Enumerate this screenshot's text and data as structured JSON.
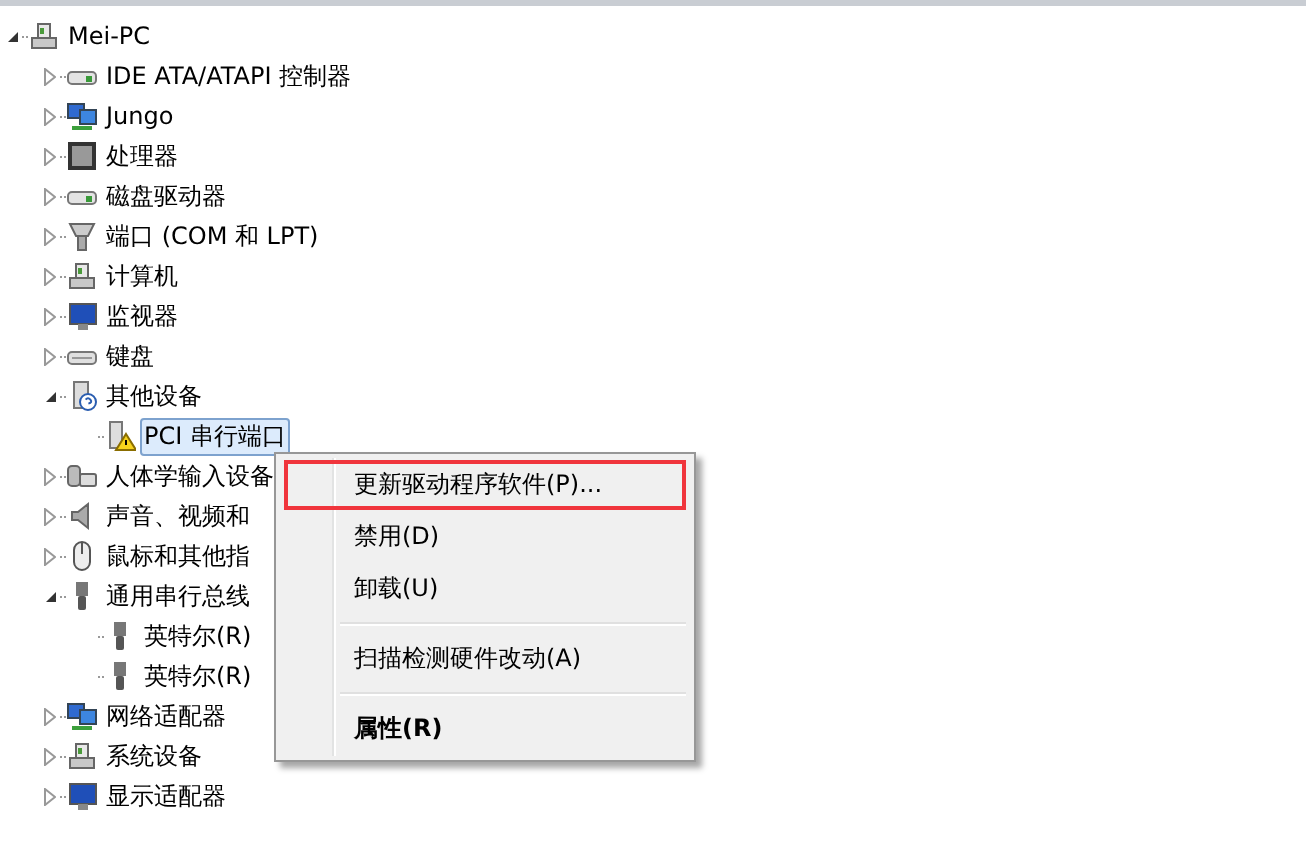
{
  "tree": [
    {
      "label": "Mei-PC",
      "expanded": true,
      "selected": false,
      "children": [
        {
          "label": "IDE ATA/ATAPI 控制器",
          "expanded": false,
          "selected": false
        },
        {
          "label": "Jungo",
          "expanded": false,
          "selected": false
        },
        {
          "label": "处理器",
          "expanded": false,
          "selected": false
        },
        {
          "label": "磁盘驱动器",
          "expanded": false,
          "selected": false
        },
        {
          "label": "端口 (COM 和 LPT)",
          "expanded": false,
          "selected": false
        },
        {
          "label": "计算机",
          "expanded": false,
          "selected": false
        },
        {
          "label": "监视器",
          "expanded": false,
          "selected": false
        },
        {
          "label": "键盘",
          "expanded": false,
          "selected": false
        },
        {
          "label": "其他设备",
          "expanded": true,
          "selected": false,
          "children": [
            {
              "label": "PCI 串行端口",
              "selected": true
            }
          ]
        },
        {
          "label": "人体学输入设备",
          "expanded": false,
          "selected": false
        },
        {
          "label": "声音、视频和",
          "expanded": false,
          "selected": false
        },
        {
          "label": "鼠标和其他指",
          "expanded": false,
          "selected": false
        },
        {
          "label": "通用串行总线",
          "expanded": true,
          "selected": false,
          "children": [
            {
              "label": "英特尔(R)",
              "selected": false
            },
            {
              "label": "英特尔(R)",
              "selected": false
            }
          ]
        },
        {
          "label": "网络适配器",
          "expanded": false,
          "selected": false
        },
        {
          "label": "系统设备",
          "expanded": false,
          "selected": false
        },
        {
          "label": "显示适配器",
          "expanded": false,
          "selected": false
        }
      ]
    }
  ],
  "context_menu": [
    {
      "kind": "item",
      "label": "更新驱动程序软件(P)...",
      "highlighted": true,
      "default": false
    },
    {
      "kind": "item",
      "label": "禁用(D)",
      "highlighted": false,
      "default": false
    },
    {
      "kind": "item",
      "label": "卸载(U)",
      "highlighted": false,
      "default": false
    },
    {
      "kind": "separator"
    },
    {
      "kind": "item",
      "label": "扫描检测硬件改动(A)",
      "highlighted": false,
      "default": false
    },
    {
      "kind": "separator"
    },
    {
      "kind": "item",
      "label": "属性(R)",
      "highlighted": false,
      "default": true
    }
  ]
}
